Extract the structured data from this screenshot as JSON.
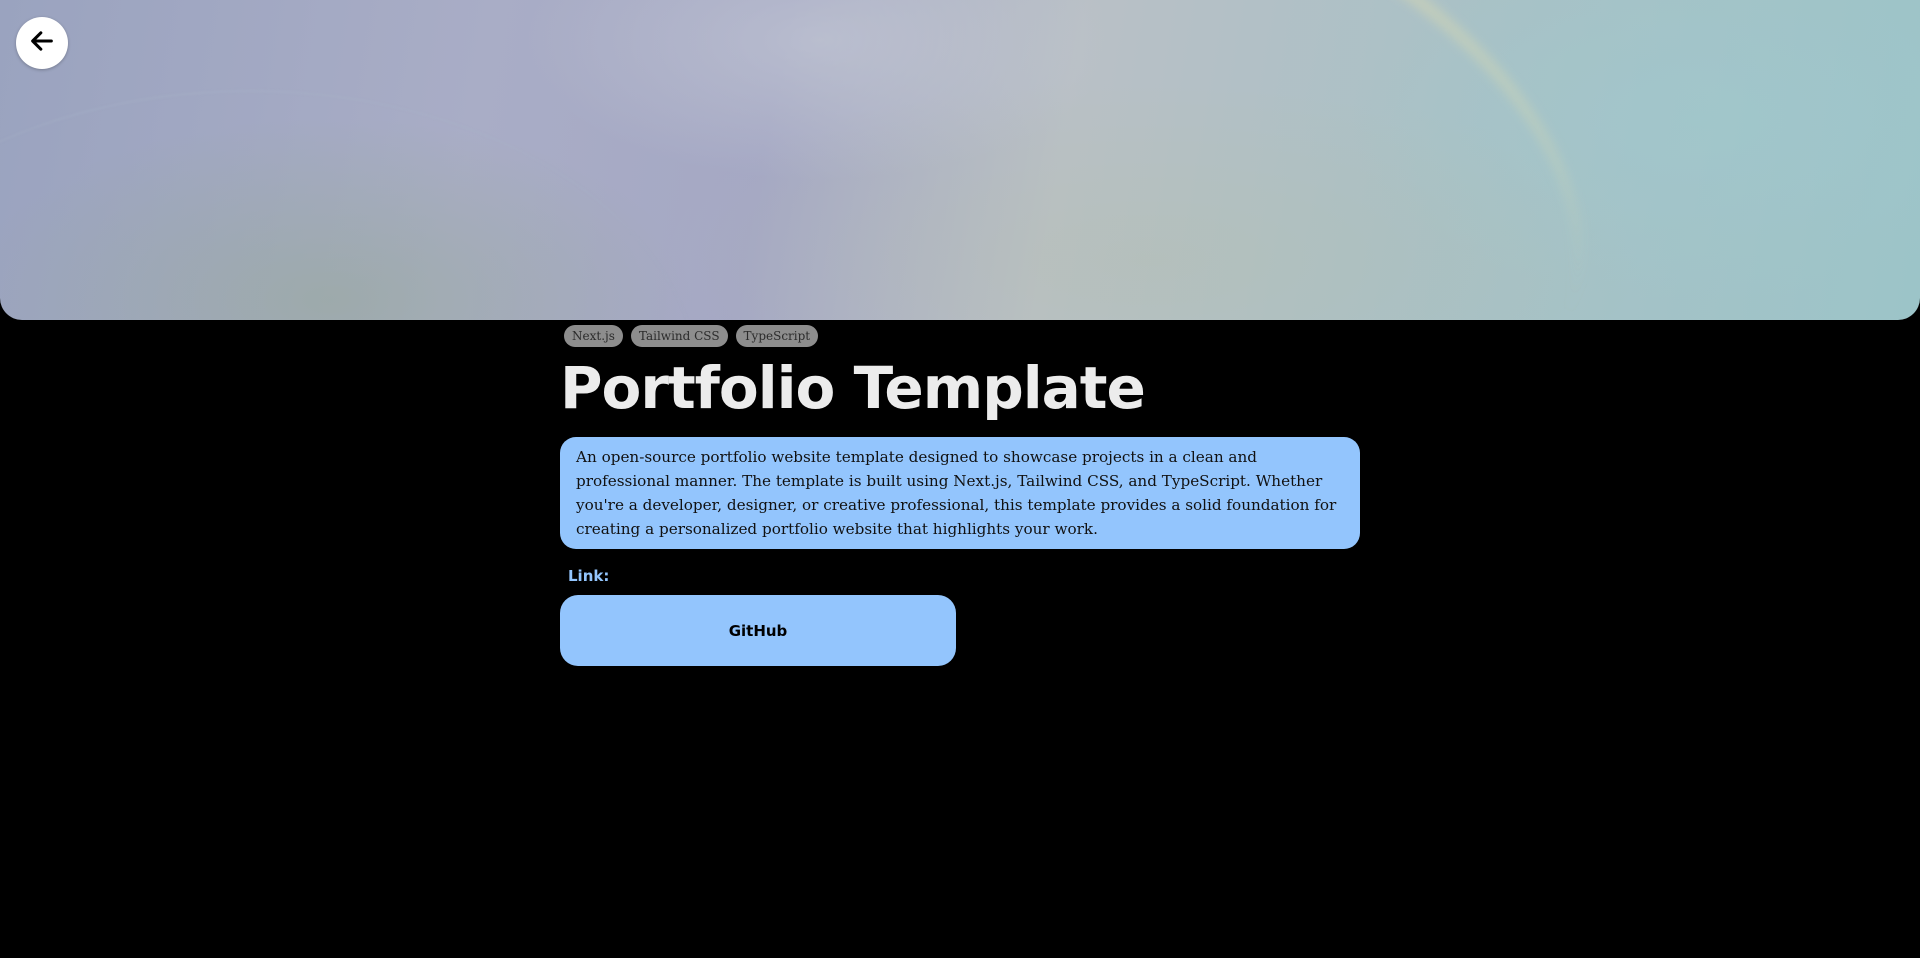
{
  "back_button": {
    "icon": "arrow-left-icon"
  },
  "tags": [
    "Next.js",
    "Tailwind CSS",
    "TypeScript"
  ],
  "title": "Portfolio Template",
  "description": "An open-source portfolio website template designed to showcase projects in a clean and professional manner. The template is built using Next.js, Tailwind CSS, and TypeScript. Whether you're a developer, designer, or creative professional, this template provides a solid foundation for creating a personalized portfolio website that highlights your work.",
  "links": {
    "label": "Link:",
    "items": [
      {
        "label": "GitHub"
      }
    ]
  },
  "colors": {
    "background": "#000000",
    "accent": "#93c5fd",
    "tag_bg": "#8d8d8d",
    "title": "#ececec"
  }
}
